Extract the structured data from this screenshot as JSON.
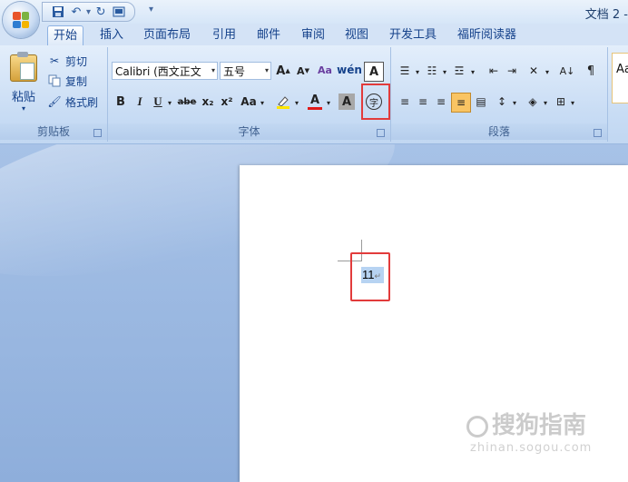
{
  "window": {
    "title": "文档 2 -"
  },
  "quick_access": {
    "save": "save-icon",
    "undo": "undo-icon",
    "redo": "redo-icon",
    "print": "print-preview-icon",
    "customize": "▾"
  },
  "tabs": [
    {
      "label": "开始",
      "active": true
    },
    {
      "label": "插入"
    },
    {
      "label": "页面布局"
    },
    {
      "label": "引用"
    },
    {
      "label": "邮件"
    },
    {
      "label": "审阅"
    },
    {
      "label": "视图"
    },
    {
      "label": "开发工具"
    },
    {
      "label": "福昕阅读器"
    }
  ],
  "clipboard": {
    "paste_label": "粘贴",
    "cut_label": "剪切",
    "copy_label": "复制",
    "format_painter_label": "格式刷",
    "group_label": "剪贴板"
  },
  "font": {
    "font_name": "Calibri (西文正文",
    "font_size": "五号",
    "grow": "A",
    "shrink": "A",
    "bold": "B",
    "italic": "I",
    "underline": "U",
    "strikethrough": "abe",
    "subscript": "x₂",
    "superscript": "x²",
    "change_case": "Aa",
    "font_color": "A",
    "char_shading": "A",
    "enclose_char": "字",
    "group_label": "字体"
  },
  "paragraph": {
    "group_label": "段落"
  },
  "styles": {
    "preview": "Aa"
  },
  "document": {
    "selected_text": "11",
    "pilcrow": "↵"
  },
  "watermark": {
    "brand": "搜狗指南",
    "url": "zhinan.sogou.com"
  },
  "colors": {
    "accent": "#15428b",
    "highlight_box": "#e23b3b",
    "selection": "#b7d3f2",
    "ribbon_bg": "#c8dcf4"
  }
}
